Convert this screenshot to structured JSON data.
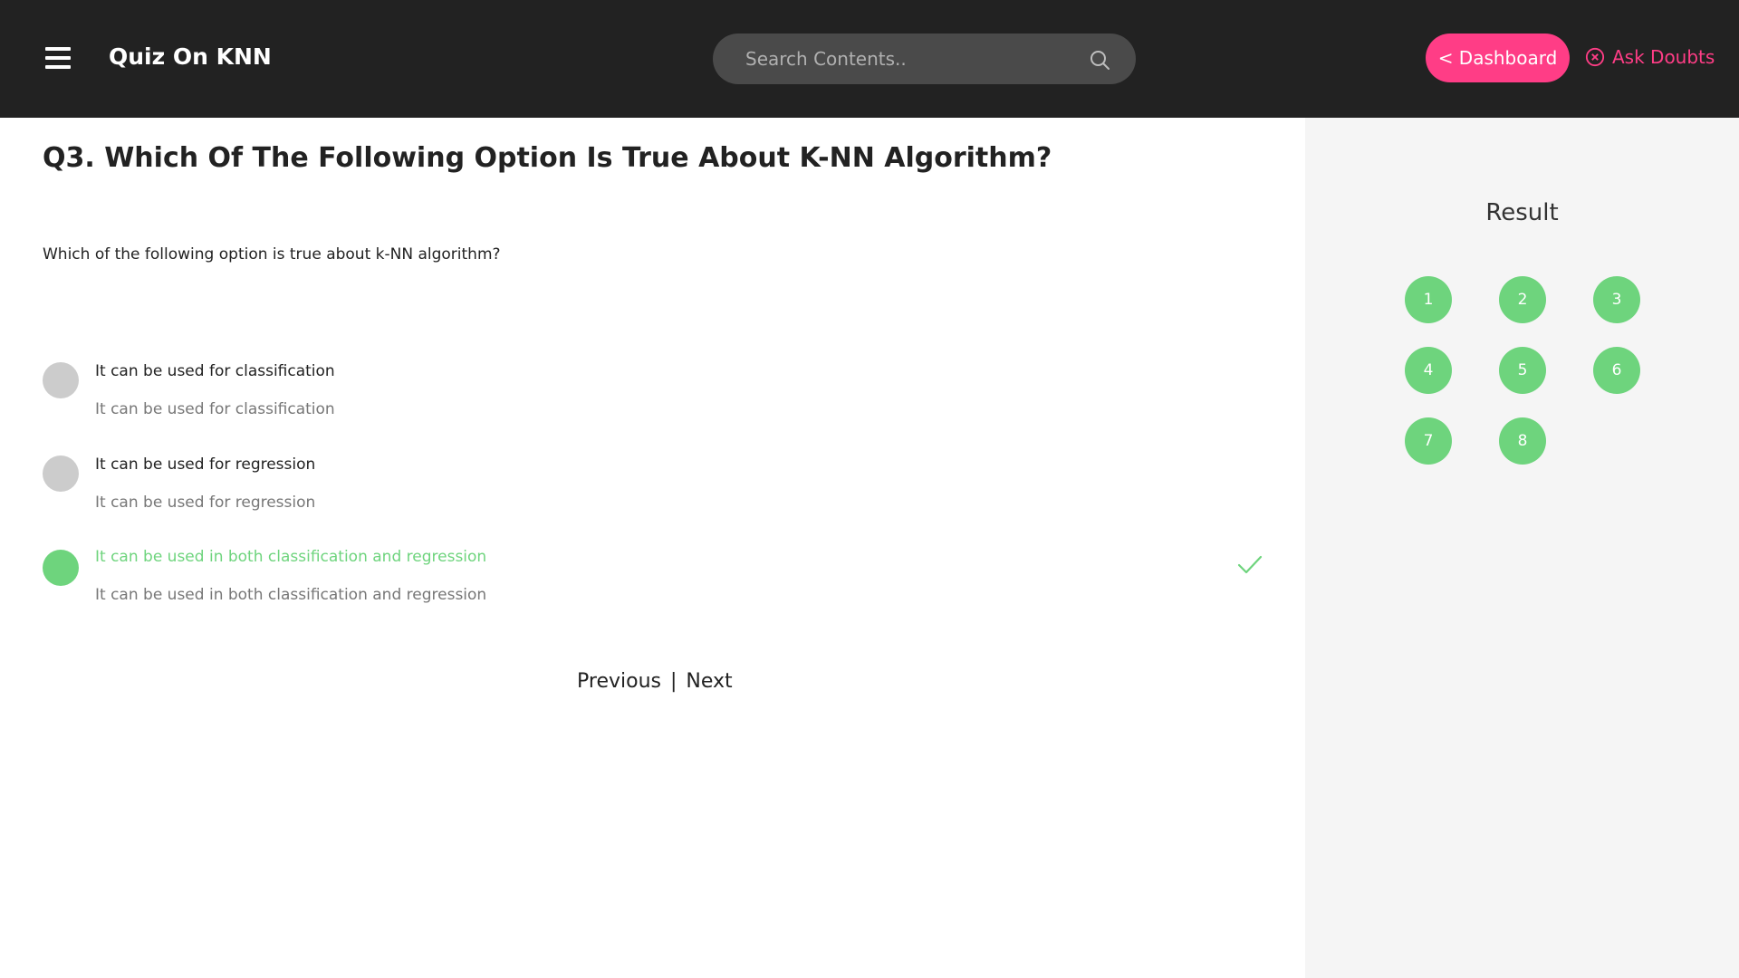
{
  "header": {
    "title": "Quiz On KNN",
    "search_placeholder": "Search Contents..",
    "dashboard_label": "< Dashboard",
    "ask_doubts_label": "Ask Doubts"
  },
  "question": {
    "title": "Q3. Which Of The Following Option Is True About K-NN Algorithm?",
    "text": "Which of the following option is true about k-NN algorithm?",
    "options": [
      {
        "label": "It can be used for classification",
        "description": "It can be used for classification",
        "state": "unselected"
      },
      {
        "label": "It can be used for regression",
        "description": "It can be used for regression",
        "state": "unselected"
      },
      {
        "label": "It can be used in both classification and regression",
        "description": "It can be used in both classification and regression",
        "state": "correct"
      }
    ]
  },
  "pager": {
    "previous": "Previous",
    "separator": "|",
    "next": "Next"
  },
  "sidebar": {
    "title": "Result",
    "questions": [
      "1",
      "2",
      "3",
      "4",
      "5",
      "6",
      "7",
      "8"
    ]
  },
  "colors": {
    "header_bg": "#222222",
    "accent_pink": "#ff3d86",
    "correct_green": "#6ed47d",
    "radio_grey": "#cccccc",
    "sidebar_bg": "#f5f5f5"
  },
  "icons": {
    "menu": "hamburger-menu-icon",
    "search": "search-icon",
    "ask_doubts": "circle-x-icon",
    "correct": "checkmark-icon"
  }
}
